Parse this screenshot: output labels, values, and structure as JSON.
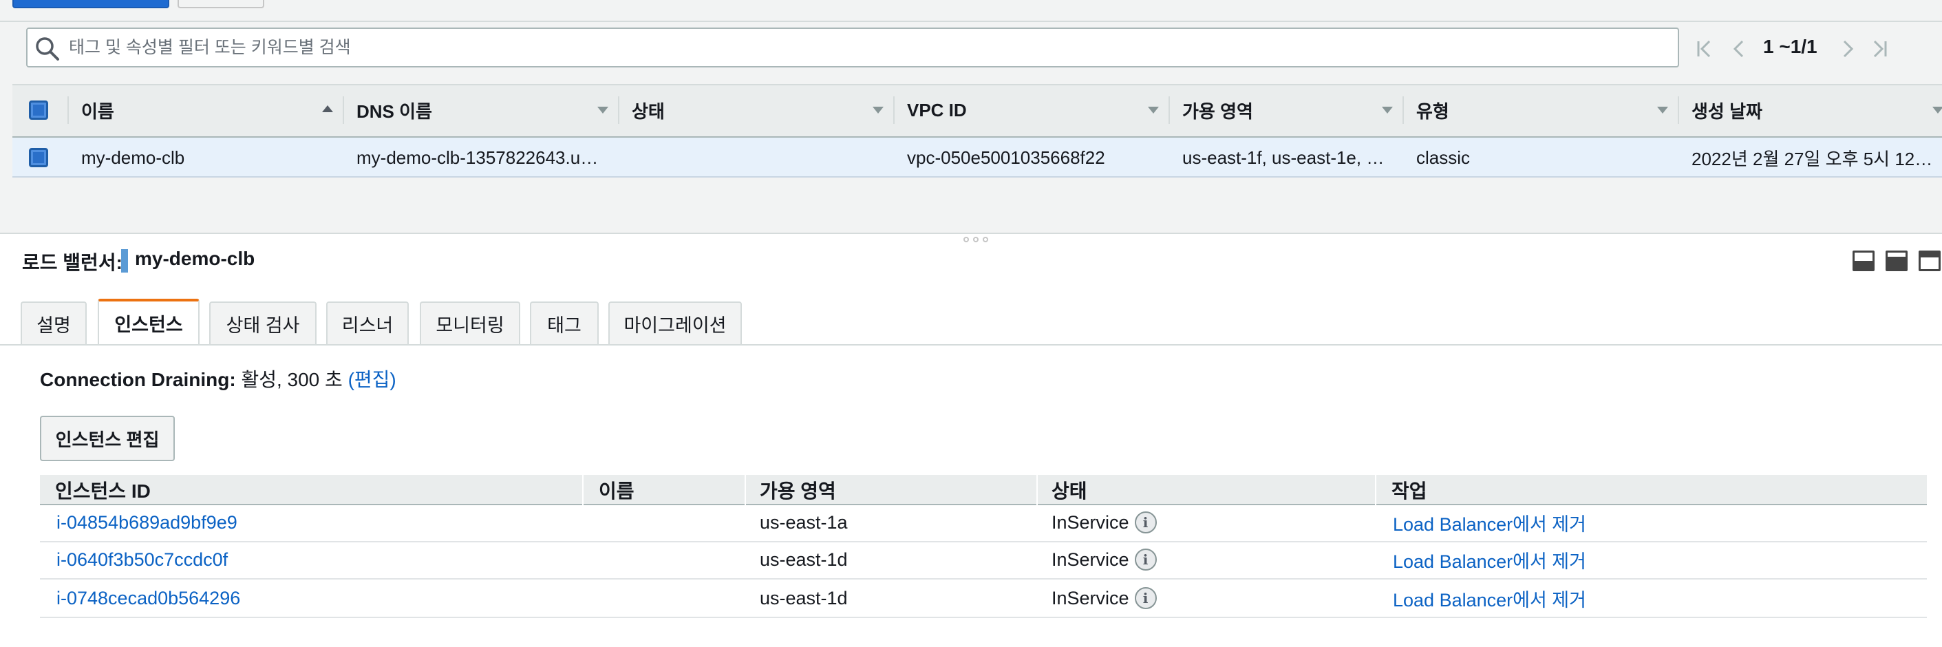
{
  "search": {
    "placeholder": "태그 및 속성별 필터 또는 키워드별 검색"
  },
  "pagination": {
    "range": "1 ~1/1"
  },
  "grid": {
    "columns": [
      "이름",
      "DNS 이름",
      "상태",
      "VPC ID",
      "가용 영역",
      "유형",
      "생성 날짜"
    ],
    "rows": [
      {
        "name": "my-demo-clb",
        "dns": "my-demo-clb-1357822643.u…",
        "state": "",
        "vpc": "vpc-050e5001035668f22",
        "az": "us-east-1f, us-east-1e, …",
        "type": "classic",
        "created": "2022년 2월 27일 오후 5시 12…"
      }
    ]
  },
  "details": {
    "label": "로드 밸런서:",
    "name": "my-demo-clb",
    "tabs": [
      "설명",
      "인스턴스",
      "상태 검사",
      "리스너",
      "모니터링",
      "태그",
      "마이그레이션"
    ],
    "active_tab": "인스턴스",
    "connection_draining": {
      "label": "Connection Draining:",
      "value": "활성, 300 초",
      "edit_link": "(편집)"
    },
    "edit_instances_button": "인스턴스 편집",
    "instances": {
      "columns": [
        "인스턴스 ID",
        "이름",
        "가용 영역",
        "상태",
        "작업"
      ],
      "rows": [
        {
          "id": "i-04854b689ad9bf9e9",
          "name": "",
          "az": "us-east-1a",
          "state": "InService",
          "action": "Load Balancer에서 제거"
        },
        {
          "id": "i-0640f3b50c7ccdc0f",
          "name": "",
          "az": "us-east-1d",
          "state": "InService",
          "action": "Load Balancer에서 제거"
        },
        {
          "id": "i-0748cecad0b564296",
          "name": "",
          "az": "us-east-1d",
          "state": "InService",
          "action": "Load Balancer에서 제거"
        }
      ]
    }
  },
  "colors": {
    "link": "#0b62c4",
    "active_tab_accent": "#ec7211",
    "selected_row": "#e7f1fb"
  }
}
